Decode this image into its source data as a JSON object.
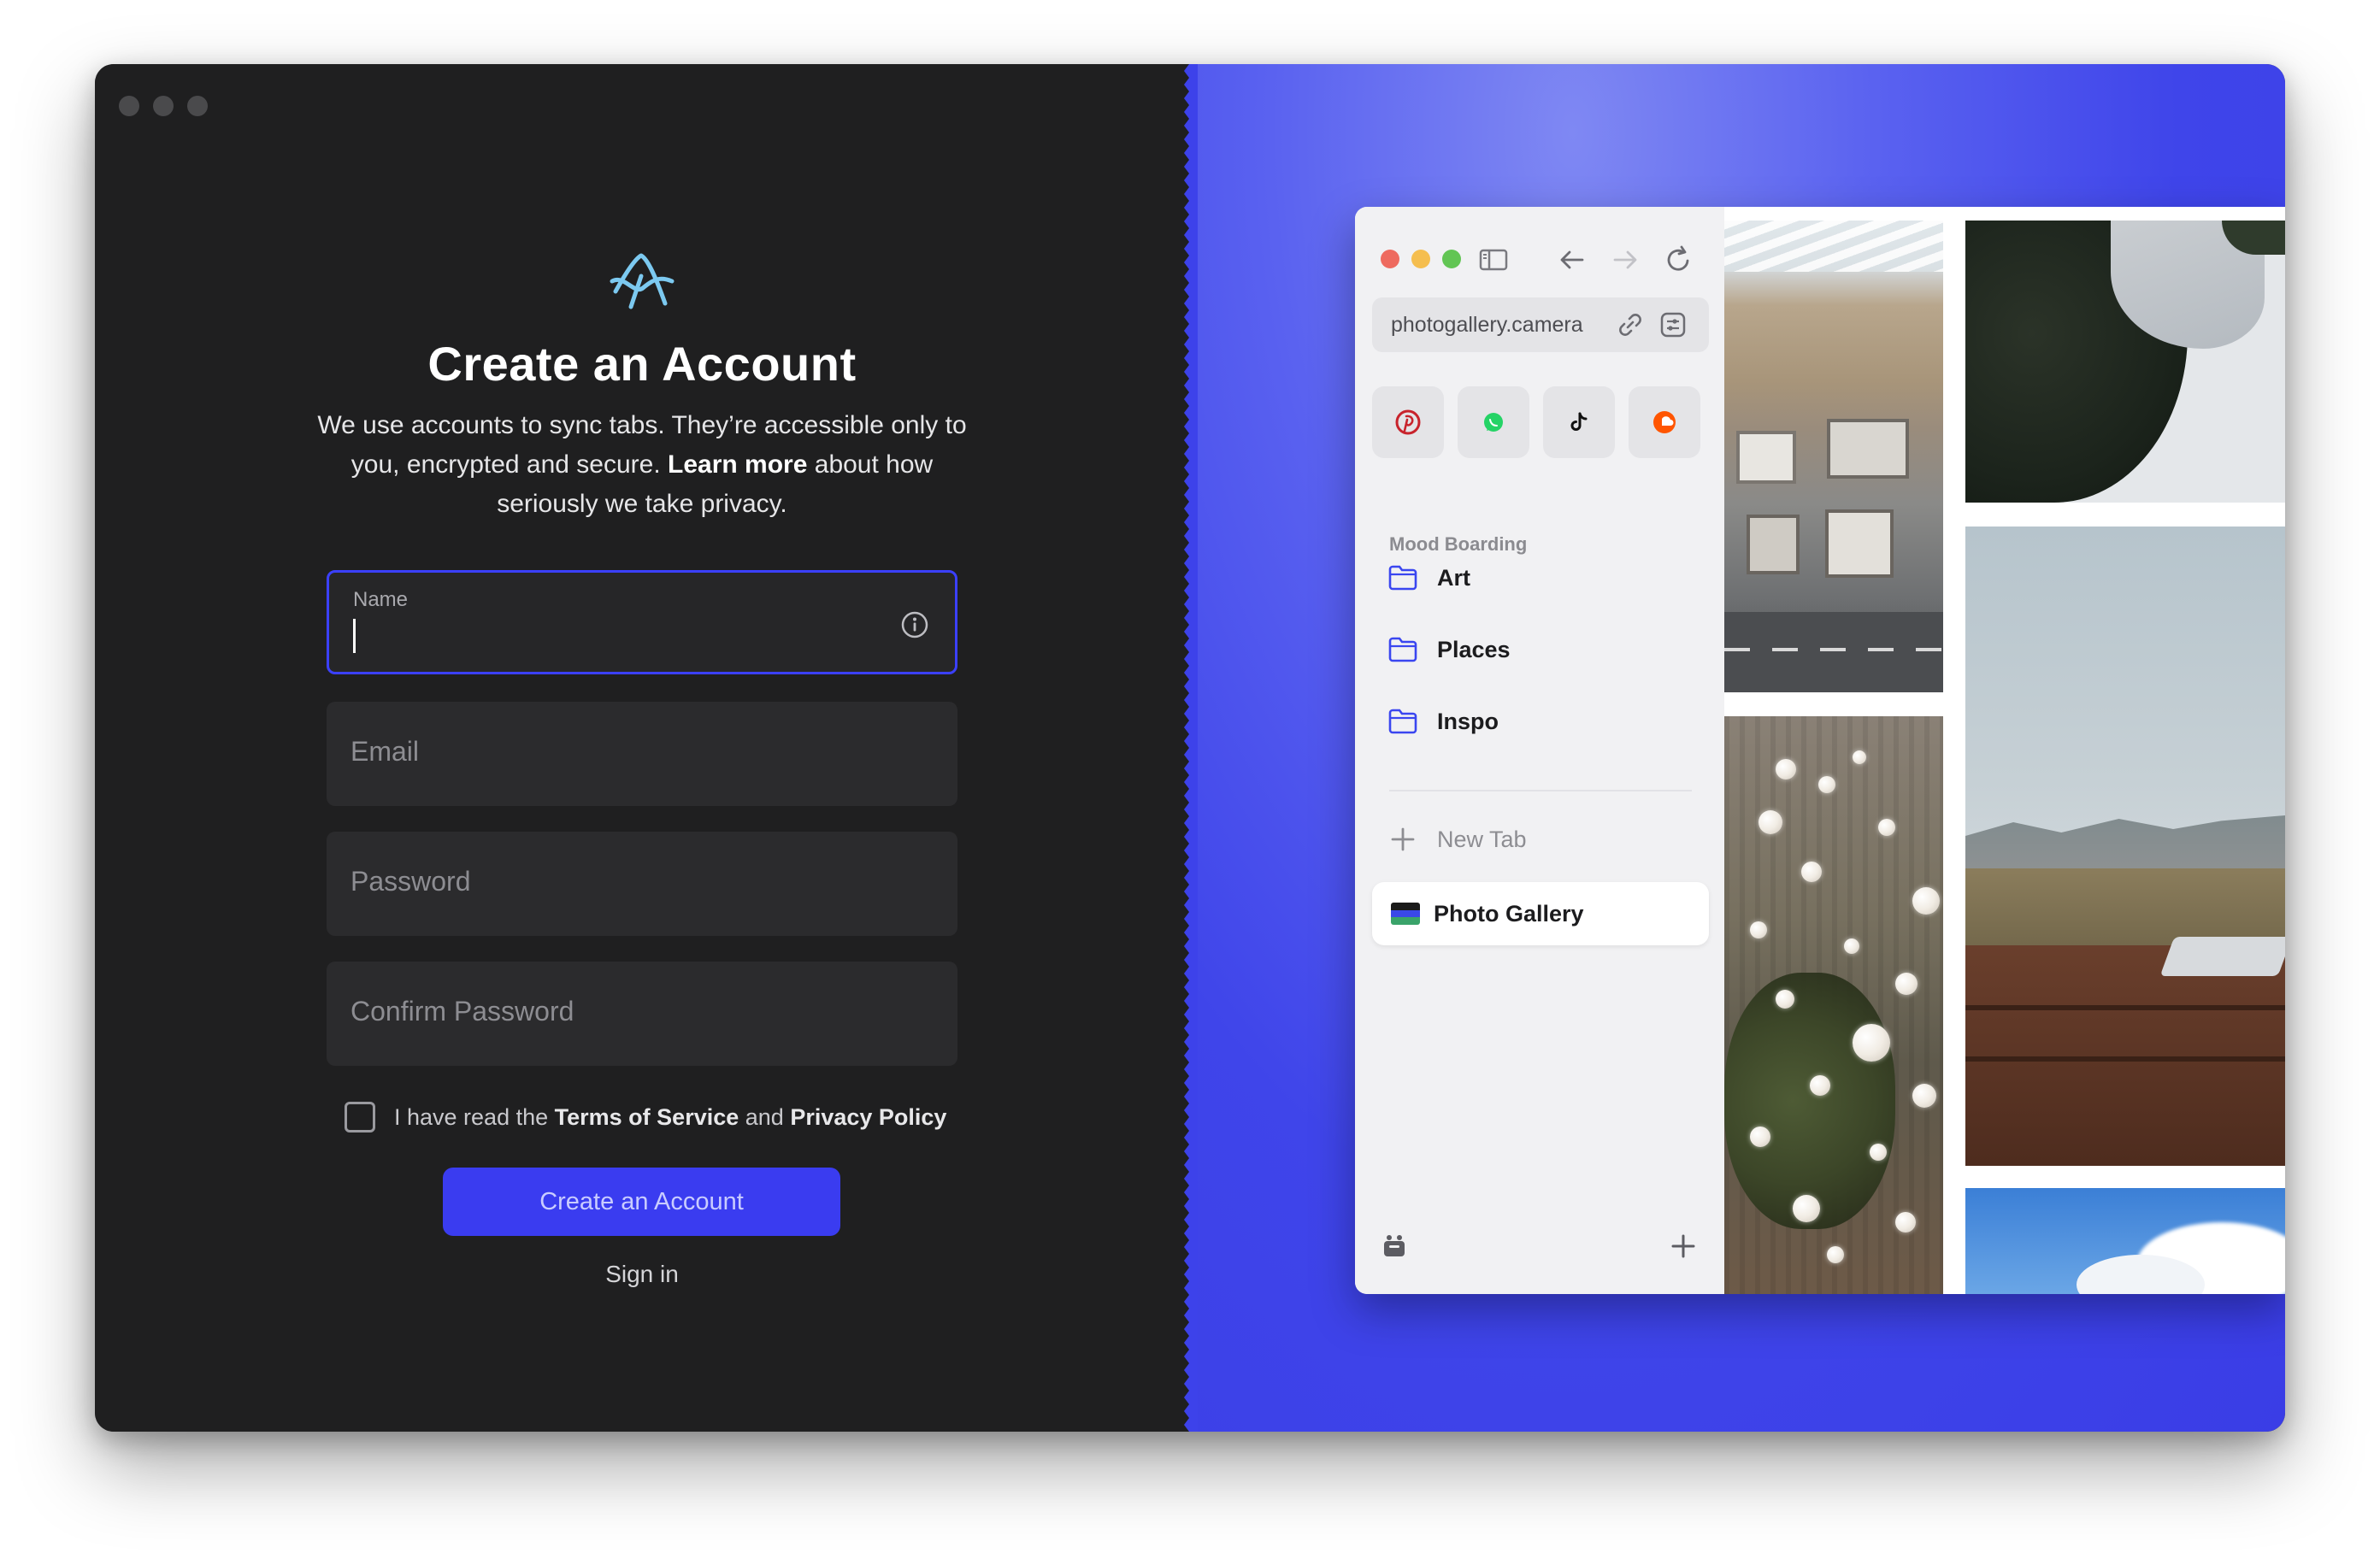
{
  "signup": {
    "title": "Create an Account",
    "subtitle_part1": "We use accounts to sync tabs. They’re accessible only to you, encrypted and secure. ",
    "subtitle_link": "Learn more",
    "subtitle_part2": " about how seriously we take privacy.",
    "fields": {
      "name_label": "Name",
      "name_value": "",
      "email_placeholder": "Email",
      "password_placeholder": "Password",
      "confirm_placeholder": "Confirm Password"
    },
    "terms": {
      "checked": false,
      "prefix": "I have read the ",
      "tos": "Terms of Service",
      "and": " and ",
      "privacy": "Privacy Policy"
    },
    "create_button": "Create an Account",
    "signin_link": "Sign in"
  },
  "browser_preview": {
    "url": "photogallery.camera",
    "favorites": [
      {
        "icon": "pinterest-icon",
        "color": "#c8232c"
      },
      {
        "icon": "whatsapp-icon",
        "color": "#25d366"
      },
      {
        "icon": "tiktok-icon",
        "color": "#111111"
      },
      {
        "icon": "soundcloud-icon",
        "color": "#ff5500"
      }
    ],
    "section_label": "Mood Boarding",
    "folders": [
      "Art",
      "Places",
      "Inspo"
    ],
    "new_tab_label": "New Tab",
    "active_tab_label": "Photo Gallery"
  },
  "colors": {
    "accent": "#3a3cf0",
    "traffic_red": "#ee6a5f",
    "traffic_yellow": "#f5be4f",
    "traffic_green": "#62c554"
  }
}
